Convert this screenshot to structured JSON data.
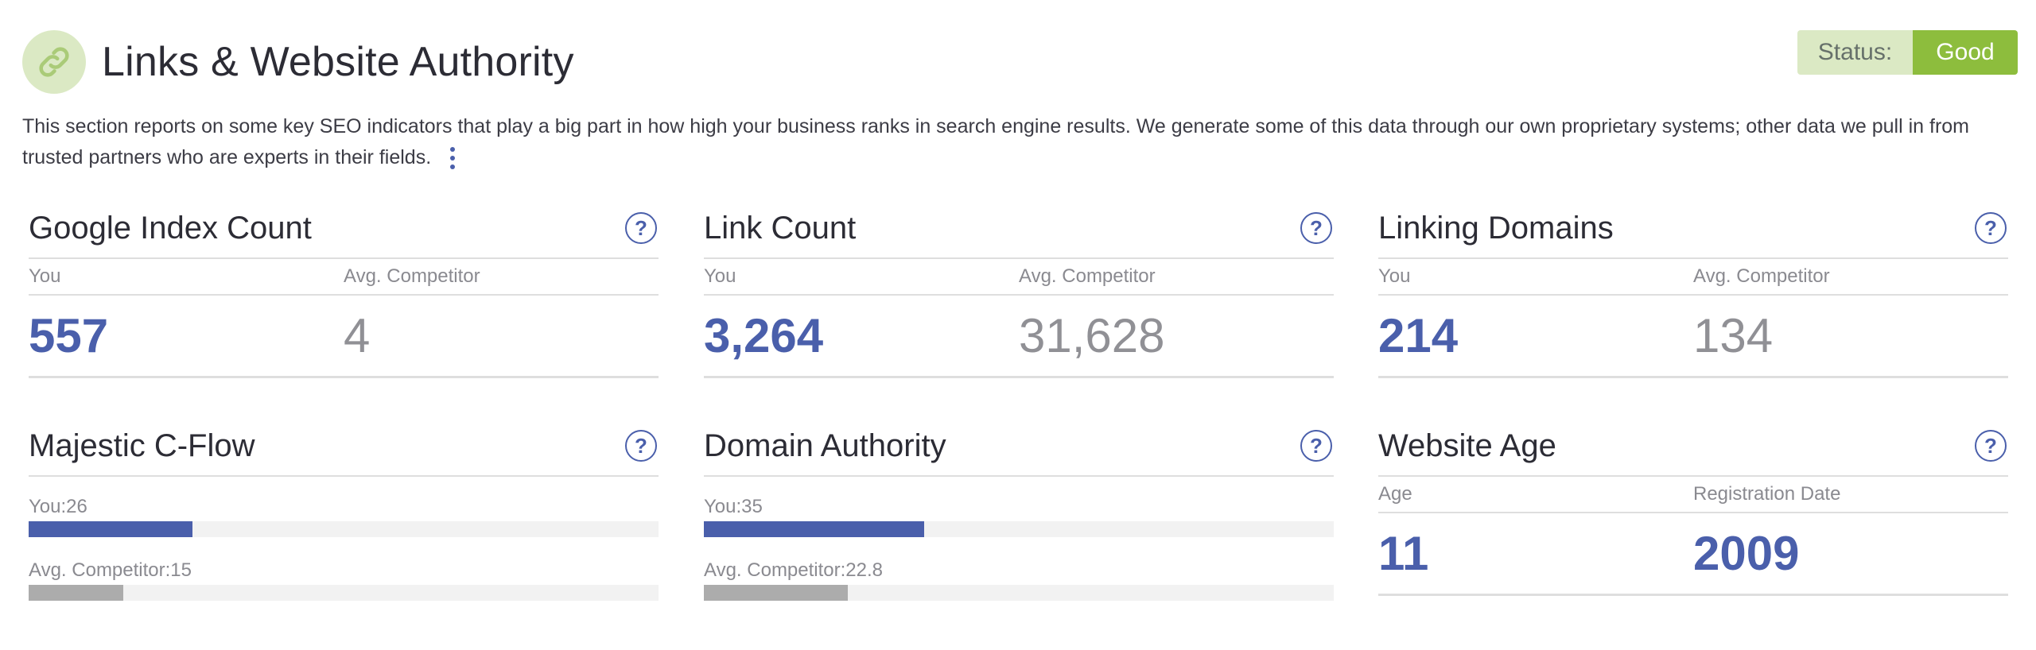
{
  "header": {
    "title": "Links & Website Authority",
    "icon": "link-icon",
    "status_label": "Status:",
    "status_value": "Good",
    "accent": "#8dbd3d"
  },
  "description": "This section reports on some key SEO indicators that play a big part in how high your business ranks in search engine results. We generate some of this data through our own proprietary systems; other data we pull in from trusted partners who are experts in their fields.",
  "cards": {
    "google_index": {
      "title": "Google Index Count",
      "col_you": "You",
      "col_avg": "Avg. Competitor",
      "you": "557",
      "avg": "4"
    },
    "link_count": {
      "title": "Link Count",
      "col_you": "You",
      "col_avg": "Avg. Competitor",
      "you": "3,264",
      "avg": "31,628"
    },
    "linking_domains": {
      "title": "Linking Domains",
      "col_you": "You",
      "col_avg": "Avg. Competitor",
      "you": "214",
      "avg": "134"
    },
    "majestic": {
      "title": "Majestic C-Flow",
      "you_label": "You:26",
      "avg_label": "Avg. Competitor:15",
      "you_value": 26,
      "avg_value": 15,
      "max": 100
    },
    "domain_authority": {
      "title": "Domain Authority",
      "you_label": "You:35",
      "avg_label": "Avg. Competitor:22.8",
      "you_value": 35,
      "avg_value": 22.8,
      "max": 100
    },
    "website_age": {
      "title": "Website Age",
      "col_you": "Age",
      "col_avg": "Registration Date",
      "you": "11",
      "avg": "2009"
    }
  },
  "colors": {
    "primary": "#4a5fab",
    "muted": "#acacac",
    "status_bg": "#dbe9c4"
  }
}
